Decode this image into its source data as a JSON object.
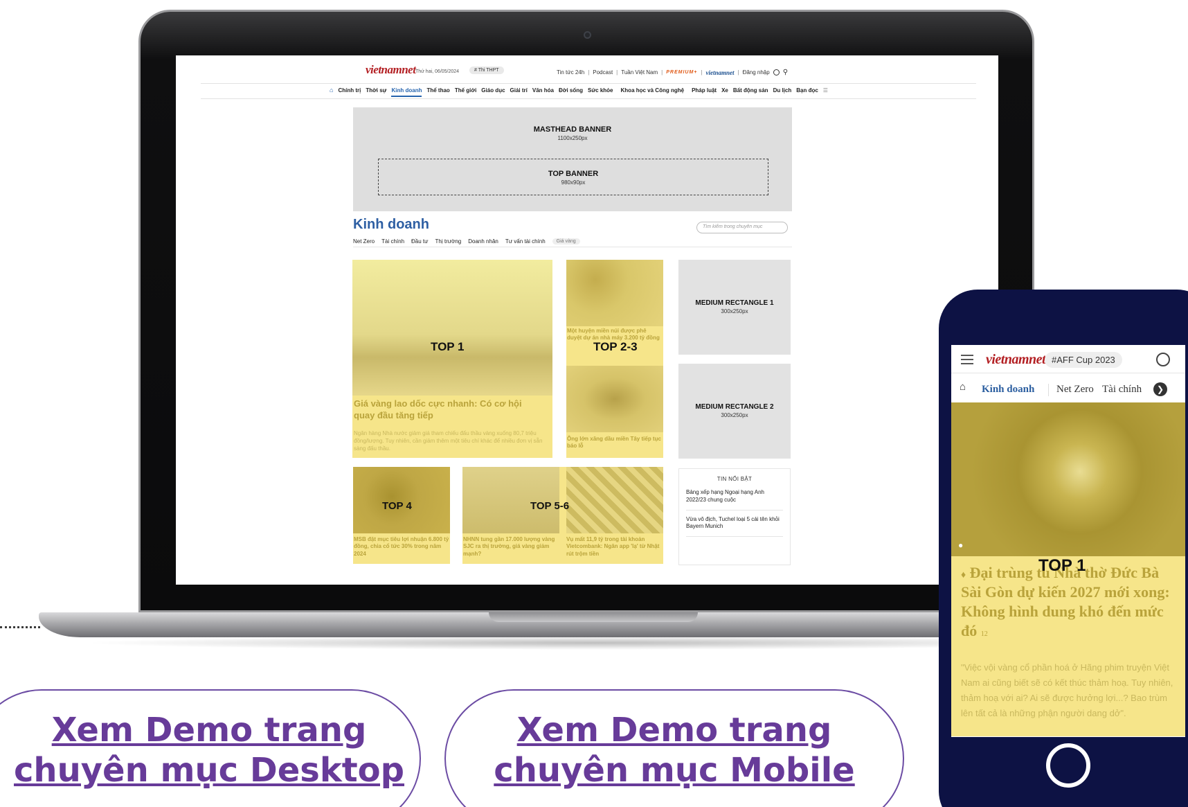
{
  "desktop": {
    "logo": "vietnamnet",
    "date": "Thứ hai, 06/05/2024",
    "tag": "# Thi THPT",
    "top_links": [
      "Tin tức 24h",
      "Podcast",
      "Tuần Việt Nam"
    ],
    "premium": "PREMIUM+",
    "logo2": "vietnamnet",
    "login": "Đăng nhập",
    "nav": [
      "Chính trị",
      "Thời sự",
      "Kinh doanh",
      "Thể thao",
      "Thế giới",
      "Giáo dục",
      "Giải trí",
      "Văn hóa",
      "Đời sống",
      "Sức khỏe",
      "Khoa học và Công nghệ",
      "Pháp luật",
      "Xe",
      "Bất động sản",
      "Du lịch",
      "Bạn đọc"
    ],
    "masthead": {
      "title": "MASTHEAD BANNER",
      "size": "1100x250px"
    },
    "top_banner": {
      "title": "TOP BANNER",
      "size": "980x90px"
    },
    "category_title": "Kinh doanh",
    "search_placeholder": "Tìm kiếm trong chuyên mục",
    "subnav": [
      "Net Zero",
      "Tài chính",
      "Đầu tư",
      "Thị trường",
      "Doanh nhân",
      "Tư vấn tài chính"
    ],
    "gold_badge": "Giá vàng",
    "top1": {
      "label": "TOP 1",
      "title": "Giá vàng lao dốc cực nhanh: Có cơ hội quay đầu tăng tiếp",
      "desc": "Ngân hàng Nhà nước giảm giá tham chiếu đấu thầu vàng xuống 80,7 triệu đồng/lượng. Tuy nhiên, cần giảm thêm một tiêu chí khác để nhiều đơn vị sẵn sàng đấu thầu."
    },
    "top23": {
      "label": "TOP 2-3",
      "title_a": "Một huyện miền núi được phê duyệt dự án nhà máy 3.200 tỷ đồng",
      "title_b": "Ông lớn xăng dầu miền Tây tiếp tục báo lỗ"
    },
    "top4": {
      "label": "TOP 4",
      "title": "MSB đặt mục tiêu lợi nhuận 6.800 tỷ đồng, chia cổ tức 30% trong năm 2024"
    },
    "top56": {
      "label": "TOP 5-6",
      "title_a": "NHNN tung gần 17.000 lượng vàng SJC ra thị trường, giá vàng giảm mạnh?",
      "title_b": "Vụ mất 11,9 tỷ trong tài khoản Vietcombank: Ngân app 'lạ' từ Nhật rút trộm tiền"
    },
    "mrec1": {
      "title": "MEDIUM RECTANGLE 1",
      "size": "300x250px"
    },
    "mrec2": {
      "title": "MEDIUM RECTANGLE 2",
      "size": "300x250px"
    },
    "featured": {
      "title": "TIN NỔI BẬT",
      "items": [
        "Bảng xếp hạng Ngoại hạng Anh 2022/23 chung cuộc",
        "Vừa vô địch, Tuchel loại 5 cái tên khỏi Bayern Munich"
      ]
    }
  },
  "mobile": {
    "logo": "vietnamnet",
    "tag": "#AFF Cup 2023",
    "nav": [
      "Kinh doanh",
      "Net Zero",
      "Tài chính"
    ],
    "top1_label": "TOP 1",
    "title": "Đại trùng tu Nhà thờ Đức Bà Sài Gòn dự kiến 2027 mới xong: Không hình dung khó đến mức đó",
    "comments": "12",
    "desc": "\"Việc vội vàng cổ phần hoá ở Hãng phim truyện Việt Nam ai cũng biết sẽ có kết thúc thảm hoạ. Tuy nhiên, thảm hoạ với ai? Ai sẽ được hưởng lợi...? Bao trùm lên tất cả là những phận người dang dở\"."
  },
  "buttons": {
    "desktop_line1": "Xem Demo trang",
    "desktop_line2": "chuyên mục Desktop",
    "mobile_line1": "Xem Demo trang",
    "mobile_line2": "chuyên mục Mobile"
  },
  "colors": {
    "brand_red": "#b31f23",
    "link_blue": "#2563ad",
    "highlight_yellow": "#f6e58a",
    "button_purple": "#673b99",
    "phone_navy": "#0d1244"
  }
}
